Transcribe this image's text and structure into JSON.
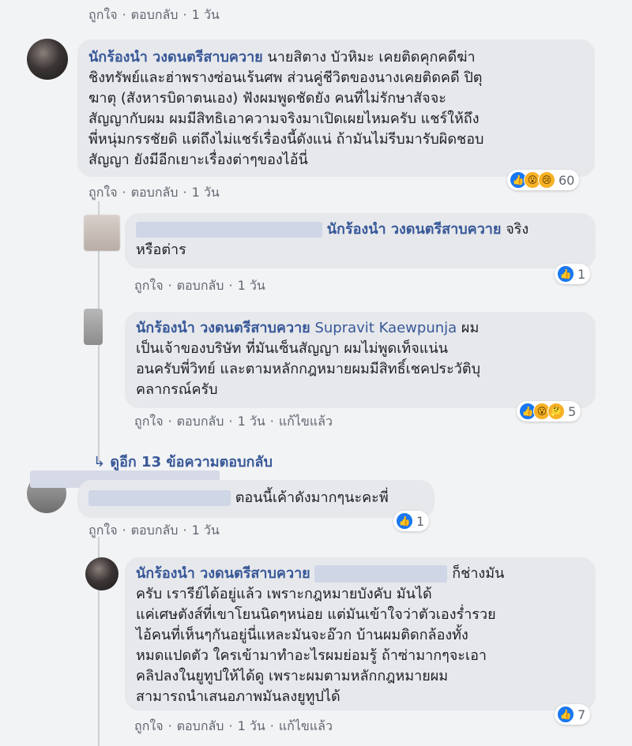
{
  "comments": [
    {
      "id": "c0",
      "actions": [
        "ถูกใจ",
        "ตอบกลับ",
        "1 วัน"
      ]
    },
    {
      "id": "c1",
      "author": "นักร้องนำ วงดนตรีสาบควาย",
      "lines": [
        "นายสิตาง บัวหิมะ เคยติดคุกคดีฆ่า",
        "ชิงทรัพย์และฮ่าพรางซ่อนเร้นศพ ส่วนคู่ชีวิตของนางเคยติดคดี ปิตุ",
        "ฆาตุ (สังหารบิดาตนเอง) ฟังผมพูดชัดยัง คนที่ไม่รักษาสัจจะ",
        "สัญญากับผม ผมมีสิทธิเอาความจริงมาเปิดเผยไหมครับ แชร์ให้ถึง",
        "พี่หนุ่มกรรชัยดิ แต่ถึงไม่แชร์เรื่องนี้ดังแน่ ถ้ามันไม่รีบมารับผิดชอบ",
        "สัญญา ยังมีอีกเยาะเรื่องต่าๆของไอ้นี่"
      ],
      "actions": [
        "ถูกใจ",
        "ตอบกลับ",
        "1 วัน"
      ],
      "reaction_count": "60"
    },
    {
      "id": "c2",
      "author_tail": "นักร้องนำ วงดนตรีสาบควาย",
      "text_first": "จริง",
      "text_second": "หรือต่าร",
      "actions": [
        "ถูกใจ",
        "ตอบกลับ",
        "1 วัน"
      ],
      "reaction_count": "1"
    },
    {
      "id": "c3",
      "author": "นักร้องนำ วงดนตรีสาบควาย",
      "mention": "Supravit Kaewpunja",
      "first_tail": "ผม",
      "lines": [
        "เป็นเจ้าของบริษัท ที่มันเซ็นสัญญา ผมไม่พูดเท็จแน่น",
        "อนครับพี่วิทย์ และตามหลักกฎหมายผมมีสิทธิ์เชคประวัติบุ",
        "คลากรณ์ครับ"
      ],
      "actions": [
        "ถูกใจ",
        "ตอบกลับ",
        "1 วัน",
        "แก้ไขแล้ว"
      ],
      "reaction_count": "5"
    },
    {
      "id": "more",
      "more_replies": "ดูอีก 13 ข้อความตอบกลับ"
    },
    {
      "id": "c4",
      "text": "ตอนนี้เค้าดังมากๆนะคะพี่",
      "actions": [
        "ถูกใจ",
        "ตอบกลับ",
        "1 วัน"
      ],
      "reaction_count": "1"
    },
    {
      "id": "c5",
      "author": "นักร้องนำ วงดนตรีสาบควาย",
      "first_tail": "ก็ช่างมัน",
      "lines": [
        "ครับ เรารีย์ได้อยู่แล้ว เพราะกฎหมายบังคับ มันได้",
        "แค่เศษตังส์ที่เขาโยนนิดๆหน่อย แต่มันเข้าใจว่าตัวเองร่ำรวย",
        "ไอ้คนที่เห็นๆกันอยู่นี่แหละมันจะอ๊วก บ้านผมติดกล้องทั้ง",
        "หมดแปดตัว ใครเข้ามาทำอะไรผมย่อมรู้ ถ้าซ่ามากๆจะเอา",
        "คลิปลงในยูทูปให้ได้ดู เพราะผมตามหลักกฎหมายผม",
        "สามารถนำเสนอภาพมันลงยูทูปได้"
      ],
      "actions": [
        "ถูกใจ",
        "ตอบกลับ",
        "1 วัน",
        "แก้ไขแล้ว"
      ],
      "reaction_count": "7"
    }
  ],
  "colors": {
    "link": "#385898",
    "bubble": "#e6e8ec",
    "bg": "#f2f3f5",
    "like": "#1877f2"
  }
}
